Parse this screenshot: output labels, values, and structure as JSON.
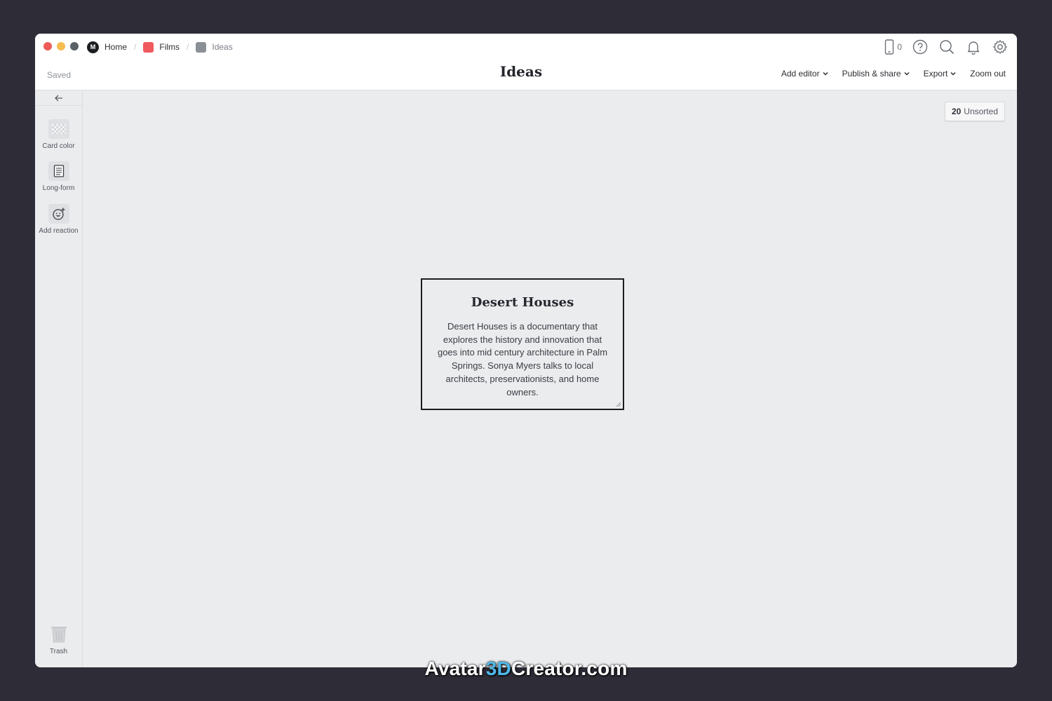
{
  "breadcrumb": {
    "home": "Home",
    "films": "Films",
    "ideas": "Ideas",
    "home_logo": "M"
  },
  "header": {
    "saved": "Saved",
    "title": "Ideas",
    "device_count": "0",
    "actions": {
      "add_editor": "Add editor",
      "publish_share": "Publish & share",
      "export": "Export",
      "zoom_out": "Zoom out"
    },
    "icons": [
      "phone-icon",
      "help-icon",
      "search-icon",
      "bell-icon",
      "gear-icon"
    ]
  },
  "sidebar": {
    "collapse_icon": "arrow-left-icon",
    "tools": [
      {
        "label": "Card color",
        "icon": "checker-icon"
      },
      {
        "label": "Long-form",
        "icon": "document-icon"
      },
      {
        "label": "Add reaction",
        "icon": "smiley-add-icon"
      }
    ],
    "trash": {
      "label": "Trash",
      "icon": "trash-icon"
    }
  },
  "canvas": {
    "unsorted_count": "20",
    "unsorted_label": "Unsorted",
    "card": {
      "title": "Desert Houses",
      "body": "Desert Houses is a documentary that explores the history and innovation that goes into mid century architecture in Palm Springs. Sonya Myers talks to local architects, preservationists, and home owners."
    }
  },
  "watermark": {
    "part1": "Avatar",
    "part2": "3D",
    "part3": "Creator.com"
  },
  "colors": {
    "background": "#2e2c37",
    "traffic_red": "#ed5c57",
    "traffic_yellow": "#f5bd4f",
    "films_color": "#ef5a5f",
    "ideas_color": "#8b9096",
    "canvas": "#ebecee"
  }
}
